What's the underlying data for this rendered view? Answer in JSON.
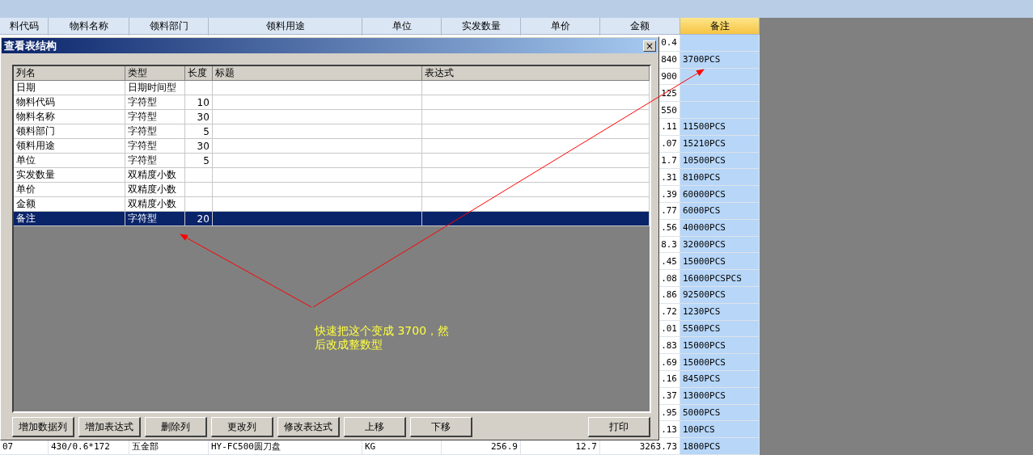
{
  "sheet": {
    "columns": [
      {
        "label": "料代码",
        "selected": false
      },
      {
        "label": "物料名称",
        "selected": false
      },
      {
        "label": "领料部门",
        "selected": false
      },
      {
        "label": "领料用途",
        "selected": false
      },
      {
        "label": "单位",
        "selected": false
      },
      {
        "label": "实发数量",
        "selected": false
      },
      {
        "label": "单价",
        "selected": false
      },
      {
        "label": "金额",
        "selected": false
      },
      {
        "label": "备注",
        "selected": true
      }
    ],
    "rows": [
      {
        "cells": [
          null,
          null,
          null,
          null,
          null,
          null,
          null,
          "0.4",
          null
        ]
      },
      {
        "cells": [
          null,
          null,
          null,
          null,
          null,
          null,
          null,
          "840",
          "3700PCS"
        ]
      },
      {
        "cells": [
          null,
          null,
          null,
          null,
          null,
          null,
          null,
          "900",
          null
        ]
      },
      {
        "cells": [
          null,
          null,
          null,
          null,
          null,
          null,
          null,
          "125",
          null
        ]
      },
      {
        "cells": [
          null,
          null,
          null,
          null,
          null,
          null,
          null,
          "550",
          null
        ]
      },
      {
        "cells": [
          null,
          null,
          null,
          null,
          null,
          null,
          null,
          ".11",
          "11500PCS"
        ]
      },
      {
        "cells": [
          null,
          null,
          null,
          null,
          null,
          null,
          null,
          ".07",
          "15210PCS"
        ]
      },
      {
        "cells": [
          null,
          null,
          null,
          null,
          null,
          null,
          null,
          "1.7",
          "10500PCS"
        ]
      },
      {
        "cells": [
          null,
          null,
          null,
          null,
          null,
          null,
          null,
          ".31",
          "8100PCS"
        ]
      },
      {
        "cells": [
          null,
          null,
          null,
          null,
          null,
          null,
          null,
          ".39",
          "60000PCS"
        ]
      },
      {
        "cells": [
          null,
          null,
          null,
          null,
          null,
          null,
          null,
          ".77",
          "6000PCS"
        ]
      },
      {
        "cells": [
          null,
          null,
          null,
          null,
          null,
          null,
          null,
          ".56",
          "40000PCS"
        ]
      },
      {
        "cells": [
          null,
          null,
          null,
          null,
          null,
          null,
          null,
          "8.3",
          "32000PCS"
        ]
      },
      {
        "cells": [
          null,
          null,
          null,
          null,
          null,
          null,
          null,
          ".45",
          "15000PCS"
        ]
      },
      {
        "cells": [
          null,
          null,
          null,
          null,
          null,
          null,
          null,
          ".08",
          "16000PCSPCS"
        ]
      },
      {
        "cells": [
          null,
          null,
          null,
          null,
          null,
          null,
          null,
          ".86",
          "92500PCS"
        ]
      },
      {
        "cells": [
          null,
          null,
          null,
          null,
          null,
          null,
          null,
          ".72",
          "1230PCS"
        ]
      },
      {
        "cells": [
          null,
          null,
          null,
          null,
          null,
          null,
          null,
          ".01",
          "5500PCS"
        ]
      },
      {
        "cells": [
          null,
          null,
          null,
          null,
          null,
          null,
          null,
          ".83",
          "15000PCS"
        ]
      },
      {
        "cells": [
          null,
          null,
          null,
          null,
          null,
          null,
          null,
          ".69",
          "15000PCS"
        ]
      },
      {
        "cells": [
          null,
          null,
          null,
          null,
          null,
          null,
          null,
          ".16",
          "8450PCS"
        ]
      },
      {
        "cells": [
          null,
          null,
          null,
          null,
          null,
          null,
          null,
          ".37",
          "13000PCS"
        ]
      },
      {
        "cells": [
          null,
          null,
          null,
          null,
          null,
          null,
          null,
          ".95",
          "5000PCS"
        ]
      },
      {
        "cells": [
          null,
          null,
          null,
          null,
          null,
          null,
          null,
          ".13",
          "100PCS"
        ]
      },
      {
        "cells": [
          "07",
          "430/0.6*172",
          "五金部",
          "HY-FC500圆刀盘",
          "KG",
          "256.9",
          "12.7",
          "3263.73",
          "1800PCS"
        ]
      }
    ]
  },
  "dialog": {
    "title": "查看表结构",
    "close": "×",
    "columns": [
      "列名",
      "类型",
      "长度",
      "标题",
      "表达式"
    ],
    "rows": [
      {
        "name": "日期",
        "type": "日期时间型",
        "selected": false
      },
      {
        "name": "物料代码",
        "type": "字符型",
        "length": "10",
        "selected": false
      },
      {
        "name": "物料名称",
        "type": "字符型",
        "length": "30",
        "selected": false
      },
      {
        "name": "领料部门",
        "type": "字符型",
        "length": "5",
        "selected": false
      },
      {
        "name": "领料用途",
        "type": "字符型",
        "length": "30",
        "selected": false
      },
      {
        "name": "单位",
        "type": "字符型",
        "length": "5",
        "selected": false
      },
      {
        "name": "实发数量",
        "type": "双精度小数",
        "selected": false
      },
      {
        "name": "单价",
        "type": "双精度小数",
        "selected": false
      },
      {
        "name": "金额",
        "type": "双精度小数",
        "selected": false
      },
      {
        "name": "备注",
        "type": "字符型",
        "length": "20",
        "selected": true
      }
    ],
    "buttons": [
      {
        "label": "增加数据列"
      },
      {
        "label": "增加表达式"
      },
      {
        "label": "删除列"
      },
      {
        "label": "更改列"
      },
      {
        "label": "修改表达式"
      },
      {
        "label": "上移"
      },
      {
        "label": "下移"
      },
      {
        "label": "打印",
        "kind": "right"
      }
    ]
  },
  "annotation": {
    "text": "快速把这个变成 3700，然后改成整数型"
  }
}
